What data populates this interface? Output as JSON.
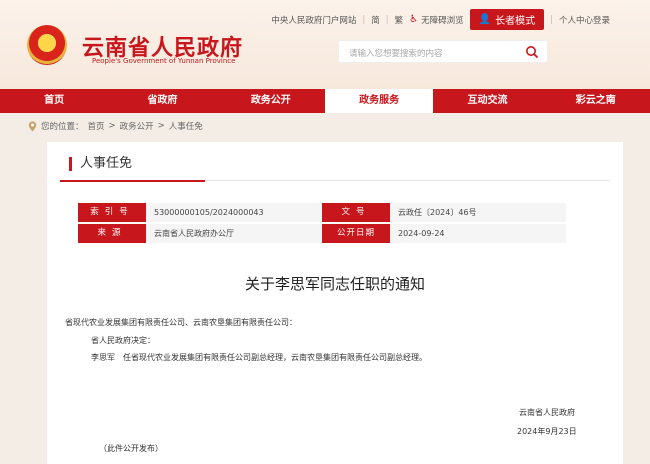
{
  "header": {
    "portal_link": "中央人民政府门户网站",
    "simplified": "简",
    "traditional": "繁",
    "accessibility": "无障碍浏览",
    "elder_mode": "长者模式",
    "user_center": "个人中心登录",
    "site_title": "云南省人民政府",
    "site_title_en": "People's Government of Yunnan Province",
    "search_placeholder": "请输入您想要搜索的内容"
  },
  "nav": {
    "items": [
      "首页",
      "省政府",
      "政务公开",
      "政务服务",
      "互动交流",
      "彩云之南"
    ],
    "active_index": 3
  },
  "breadcrumb": {
    "prefix": "您的位置：",
    "items": [
      "首页",
      "政务公开",
      "人事任免"
    ]
  },
  "section": {
    "title": "人事任免"
  },
  "meta": {
    "index_label": "索引号",
    "index_value": "53000000105/2024000043",
    "docno_label": "文号",
    "docno_value": "云政任〔2024〕46号",
    "org_label": "来源",
    "org_value": "云南省人民政府办公厅",
    "date_label": "公开日期",
    "date_value": "2024-09-24"
  },
  "document": {
    "title": "关于李思军同志任职的通知",
    "addressee": "省现代农业发展集团有限责任公司、云南农垦集团有限责任公司：",
    "decided": "省人民政府决定：",
    "body": "李思军　任省现代农业发展集团有限责任公司副总经理，云南农垦集团有限责任公司副总经理。",
    "signer": "云南省人民政府",
    "sign_date": "2024年9月23日",
    "note": "（此件公开发布）"
  },
  "colors": {
    "brand_red": "#c8161d"
  }
}
